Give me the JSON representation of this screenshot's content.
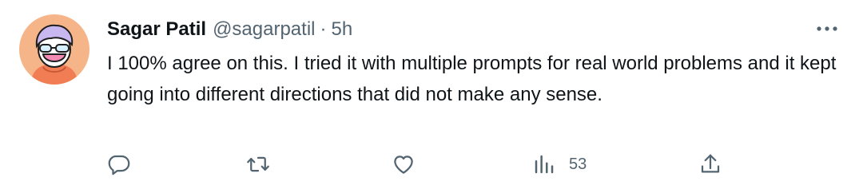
{
  "author": {
    "name": "Sagar Patil",
    "handle": "@sagarpatil",
    "separator": "·",
    "time": "5h"
  },
  "tweet": {
    "text": "I 100% agree on this. I tried it with multiple prompts for real world problems and it kept going into different directions that did not make any sense."
  },
  "actions": {
    "reply": {
      "icon": "reply-icon"
    },
    "retweet": {
      "icon": "retweet-icon"
    },
    "like": {
      "icon": "heart-icon"
    },
    "views": {
      "icon": "bar-chart-icon",
      "count": "53"
    },
    "share": {
      "icon": "share-icon"
    }
  },
  "colors": {
    "text_primary": "#0f1419",
    "text_secondary": "#536471",
    "avatar_bg": "#f6b589"
  }
}
